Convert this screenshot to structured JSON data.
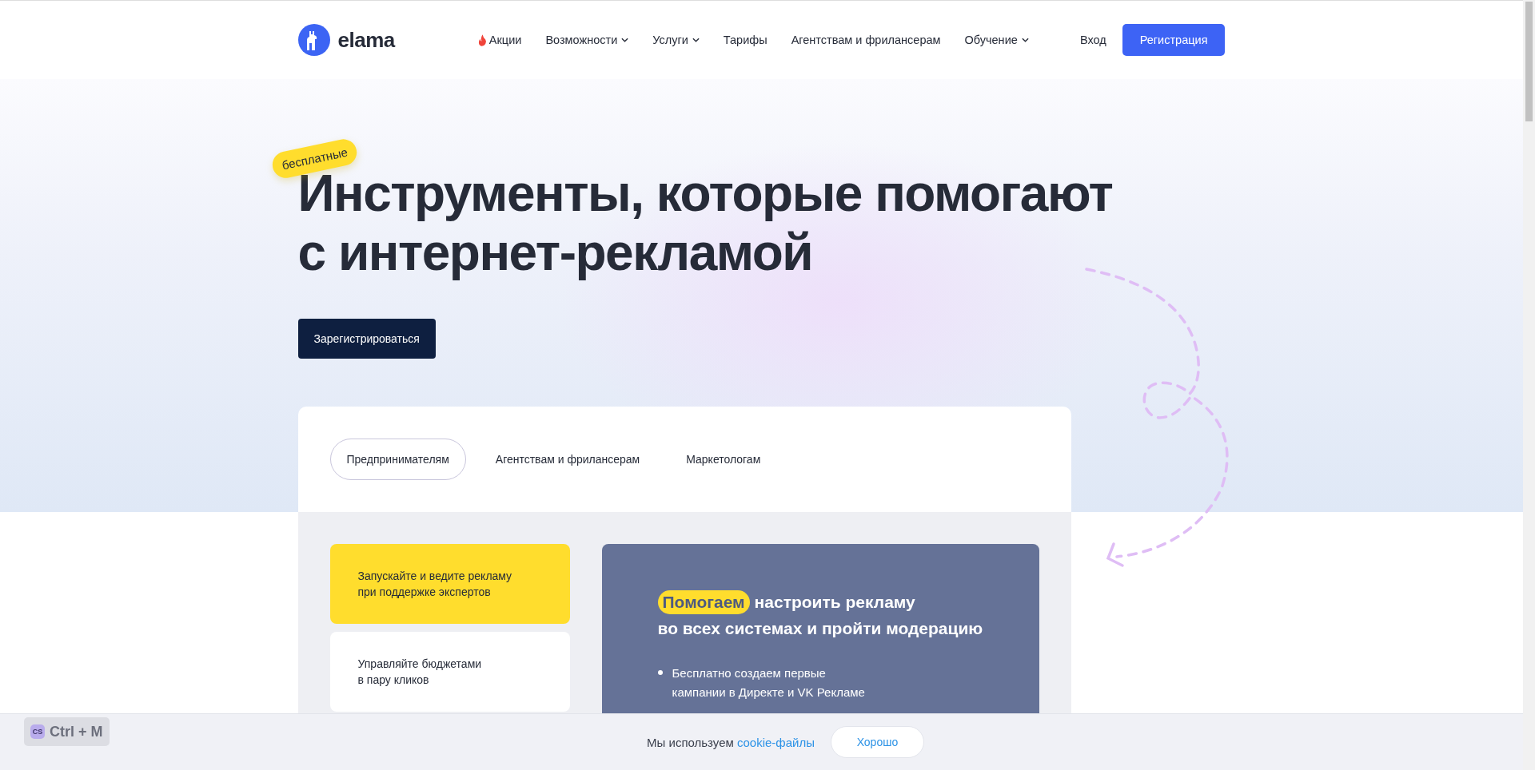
{
  "header": {
    "logo": "elama",
    "nav": [
      {
        "label": "Акции",
        "kind": "promo"
      },
      {
        "label": "Возможности",
        "kind": "dropdown"
      },
      {
        "label": "Услуги",
        "kind": "dropdown"
      },
      {
        "label": "Тарифы",
        "kind": "link"
      },
      {
        "label": "Агентствам и фрилансерам",
        "kind": "link"
      },
      {
        "label": "Обучение",
        "kind": "dropdown"
      }
    ],
    "login": "Вход",
    "register": "Регистрация"
  },
  "hero": {
    "badge": "бесплатные",
    "title_lines": [
      "Инструменты, которые помогают",
      "с интернет-рекламой"
    ],
    "cta": "Зарегистрироваться"
  },
  "audience_tabs": [
    {
      "label": "Предпринимателям",
      "selected": true
    },
    {
      "label": "Агентствам и фрилансерам",
      "selected": false
    },
    {
      "label": "Маркетологам",
      "selected": false
    }
  ],
  "features": [
    {
      "text": "Запускайте и ведите рекламу\nпри поддержке экспертов",
      "selected": true
    },
    {
      "text": "Управляйте бюджетами\nв пару кликов",
      "selected": false
    }
  ],
  "feature_detail": {
    "highlight": "Помогаем",
    "title_rest": "настроить рекламу",
    "title_line2": "во всех системах и пройти модерацию",
    "bullets": [
      "Бесплатно создаем первые\nкампании в Директе и VK Рекламе"
    ]
  },
  "cookie_bar": {
    "text": "Мы используем",
    "link": "cookie-файлы",
    "button": "Хорошо"
  },
  "extension_badge": {
    "icon_text": "CS",
    "shortcut": "Ctrl + M"
  }
}
